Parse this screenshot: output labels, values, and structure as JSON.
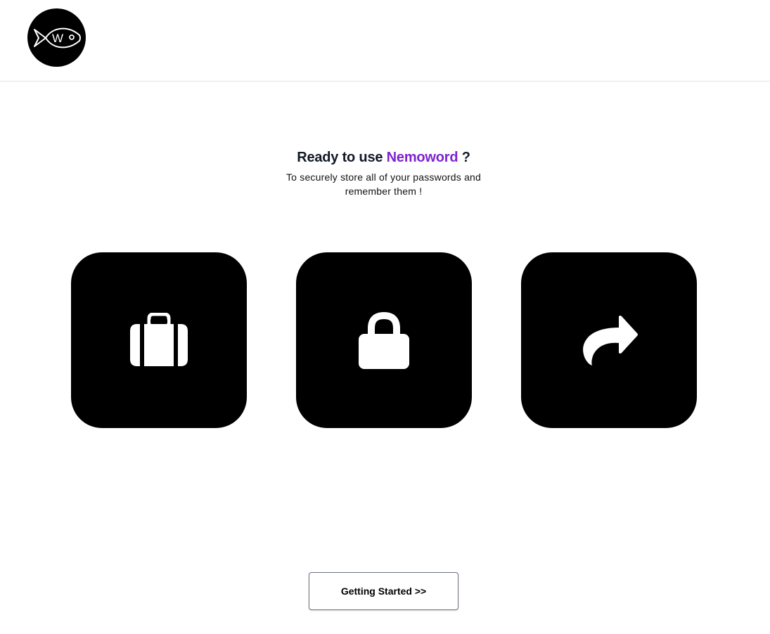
{
  "header": {
    "logo_icon": "fish-w-logo-icon",
    "logo_letter": "W"
  },
  "hero": {
    "title_prefix": "Ready to use ",
    "brand_name": "Nemoword",
    "title_suffix": " ?",
    "subtitle": "To securely store all of your passwords and remember them !"
  },
  "features": [
    {
      "icon": "briefcase-icon"
    },
    {
      "icon": "lock-icon"
    },
    {
      "icon": "share-forward-icon"
    }
  ],
  "cta": {
    "label": "Getting Started >>"
  },
  "colors": {
    "brand": "#7e22ce",
    "title": "#111827",
    "card": "#000000"
  }
}
